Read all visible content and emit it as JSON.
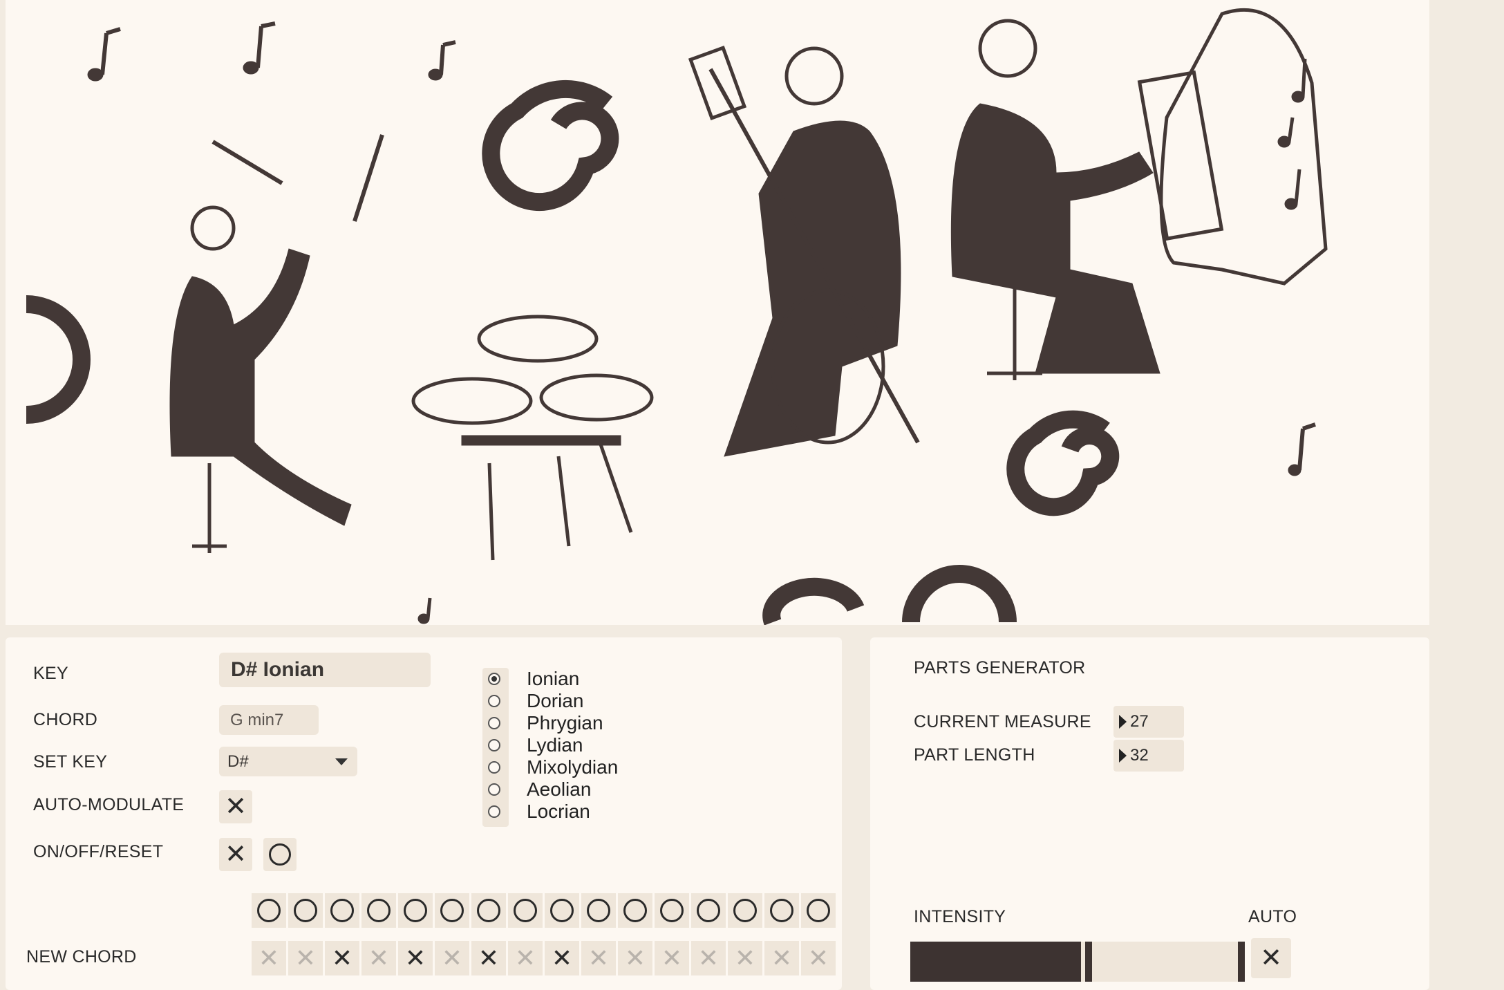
{
  "controls": {
    "key": {
      "label": "KEY",
      "value": "D# Ionian"
    },
    "chord": {
      "label": "CHORD",
      "value": "G min7"
    },
    "set_key": {
      "label": "SET KEY",
      "value": "D#"
    },
    "auto_modulate": {
      "label": "AUTO-MODULATE",
      "checked": true
    },
    "on_off_reset": {
      "label": "ON/OFF/RESET"
    },
    "new_chord": {
      "label": "NEW CHORD"
    },
    "modes": [
      {
        "label": "Ionian",
        "selected": true
      },
      {
        "label": "Dorian",
        "selected": false
      },
      {
        "label": "Phrygian",
        "selected": false
      },
      {
        "label": "Lydian",
        "selected": false
      },
      {
        "label": "Mixolydian",
        "selected": false
      },
      {
        "label": "Aeolian",
        "selected": false
      },
      {
        "label": "Locrian",
        "selected": false
      }
    ],
    "step_circles_count": 16,
    "new_chord_steps": [
      false,
      false,
      true,
      false,
      true,
      false,
      true,
      false,
      true,
      false,
      false,
      false,
      false,
      false,
      false,
      false
    ]
  },
  "parts_generator": {
    "title": "PARTS GENERATOR",
    "current_measure": {
      "label": "CURRENT MEASURE",
      "value": "27"
    },
    "part_length": {
      "label": "PART LENGTH",
      "value": "32"
    },
    "intensity": {
      "label": "INTENSITY",
      "level": 0.51
    },
    "auto": {
      "label": "AUTO",
      "checked": true
    }
  },
  "colors": {
    "panel": "#fdf8f2",
    "field": "#efe6da",
    "ink": "#3d3331"
  },
  "icons": [
    "cross-mark-icon",
    "circle-mark-icon",
    "dropdown-caret-icon",
    "number-arrow-icon",
    "radio-icon"
  ]
}
